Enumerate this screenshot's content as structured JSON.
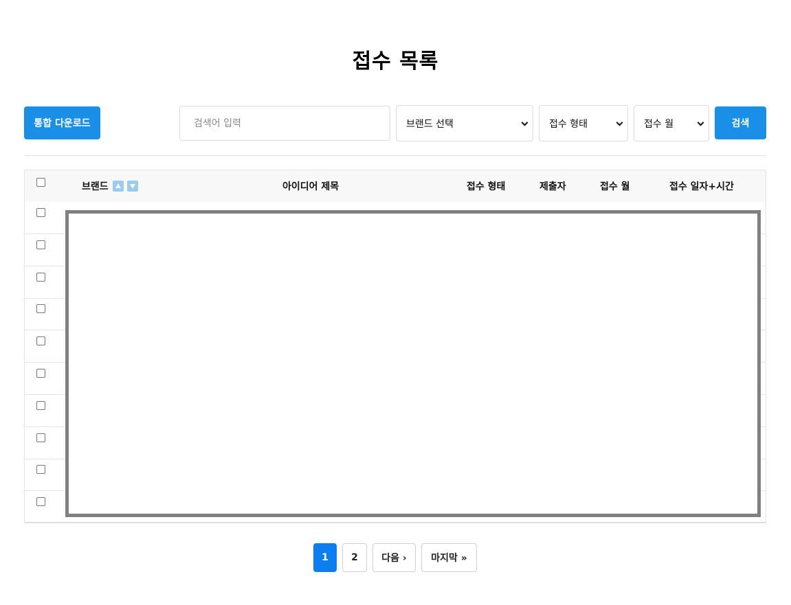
{
  "page": {
    "title": "접수 목록"
  },
  "toolbar": {
    "download_label": "통합 다운로드",
    "search_placeholder": "검색어 입력",
    "search_value": "",
    "brand_select": "브랜드 선택",
    "type_select": "접수 형태",
    "month_select": "접수 월",
    "search_label": "검색"
  },
  "table": {
    "columns": {
      "brand": "브랜드",
      "title": "아이디어 제목",
      "type": "접수 형태",
      "submitter": "제출자",
      "month": "접수 월",
      "datetime": "접수 일자+시간"
    },
    "row_count": 10
  },
  "pagination": {
    "pages": [
      "1",
      "2"
    ],
    "current": "1",
    "next_label": "다음 ›",
    "last_label": "마지막 »"
  },
  "colors": {
    "primary_button": "#1a8fe8",
    "active_page": "#0d7ef0",
    "sort_icon": "#9ccbf0",
    "overlay_border": "#808080"
  }
}
